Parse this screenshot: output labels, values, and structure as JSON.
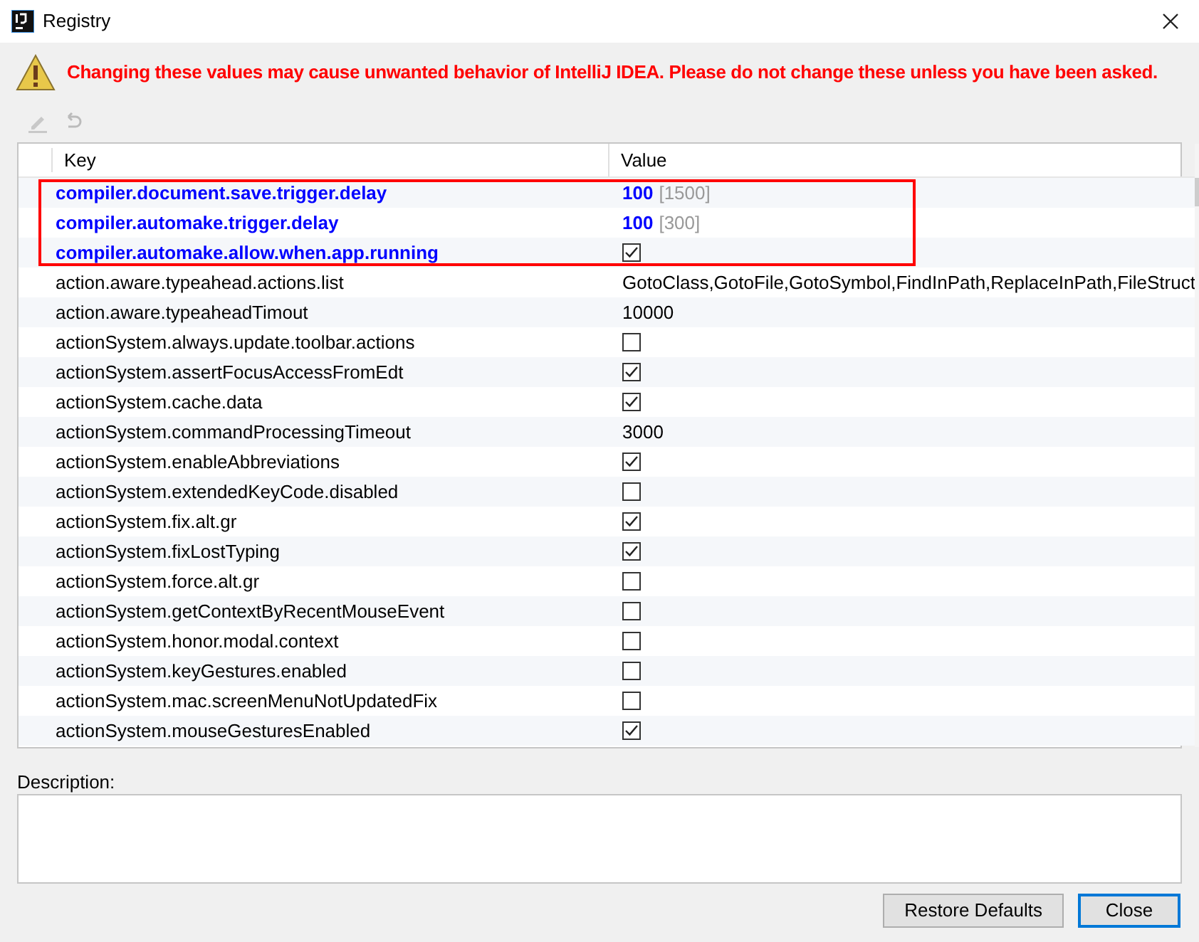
{
  "window": {
    "title": "Registry"
  },
  "warning": "Changing these values may cause unwanted behavior of IntelliJ IDEA. Please do not change these unless you have been asked.",
  "table": {
    "columns": [
      "Key",
      "Value"
    ],
    "rows": [
      {
        "key": "compiler.document.save.trigger.delay",
        "kind": "text",
        "value": "100",
        "default": "[1500]",
        "modified": true
      },
      {
        "key": "compiler.automake.trigger.delay",
        "kind": "text",
        "value": "100",
        "default": "[300]",
        "modified": true
      },
      {
        "key": "compiler.automake.allow.when.app.running",
        "kind": "checkbox",
        "checked": true,
        "modified": true
      },
      {
        "key": "action.aware.typeahead.actions.list",
        "kind": "text",
        "value": "GotoClass,GotoFile,GotoSymbol,FindInPath,ReplaceInPath,FileStruct",
        "modified": false
      },
      {
        "key": "action.aware.typeaheadTimout",
        "kind": "text",
        "value": "10000",
        "modified": false
      },
      {
        "key": "actionSystem.always.update.toolbar.actions",
        "kind": "checkbox",
        "checked": false,
        "modified": false
      },
      {
        "key": "actionSystem.assertFocusAccessFromEdt",
        "kind": "checkbox",
        "checked": true,
        "modified": false
      },
      {
        "key": "actionSystem.cache.data",
        "kind": "checkbox",
        "checked": true,
        "modified": false
      },
      {
        "key": "actionSystem.commandProcessingTimeout",
        "kind": "text",
        "value": "3000",
        "modified": false
      },
      {
        "key": "actionSystem.enableAbbreviations",
        "kind": "checkbox",
        "checked": true,
        "modified": false
      },
      {
        "key": "actionSystem.extendedKeyCode.disabled",
        "kind": "checkbox",
        "checked": false,
        "modified": false
      },
      {
        "key": "actionSystem.fix.alt.gr",
        "kind": "checkbox",
        "checked": true,
        "modified": false
      },
      {
        "key": "actionSystem.fixLostTyping",
        "kind": "checkbox",
        "checked": true,
        "modified": false
      },
      {
        "key": "actionSystem.force.alt.gr",
        "kind": "checkbox",
        "checked": false,
        "modified": false
      },
      {
        "key": "actionSystem.getContextByRecentMouseEvent",
        "kind": "checkbox",
        "checked": false,
        "modified": false
      },
      {
        "key": "actionSystem.honor.modal.context",
        "kind": "checkbox",
        "checked": false,
        "modified": false
      },
      {
        "key": "actionSystem.keyGestures.enabled",
        "kind": "checkbox",
        "checked": false,
        "modified": false
      },
      {
        "key": "actionSystem.mac.screenMenuNotUpdatedFix",
        "kind": "checkbox",
        "checked": false,
        "modified": false
      },
      {
        "key": "actionSystem.mouseGesturesEnabled",
        "kind": "checkbox",
        "checked": true,
        "modified": false
      }
    ]
  },
  "description": {
    "label": "Description:"
  },
  "buttons": [
    {
      "label": "Restore Defaults",
      "focused": false
    },
    {
      "label": "Close",
      "focused": true
    }
  ]
}
